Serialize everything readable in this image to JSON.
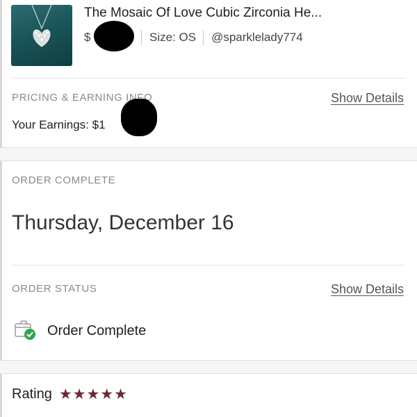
{
  "product": {
    "title": "The Mosaic Of Love Cubic Zirconia He...",
    "price_prefix": "$",
    "size": "Size: OS",
    "seller": "@sparklelady774",
    "image_icon": "heart-pendant-necklace-image"
  },
  "pricing": {
    "section_label": "PRICING & EARNING INFO",
    "show_details": "Show Details",
    "earnings": "Your Earnings: $1"
  },
  "order_complete": {
    "section_label": "ORDER COMPLETE",
    "date": "Thursday, December 16"
  },
  "order_status": {
    "section_label": "ORDER STATUS",
    "show_details": "Show Details",
    "status_text": "Order Complete",
    "status_icon": "package-check-icon"
  },
  "rating": {
    "label": "Rating",
    "stars": 5,
    "stars_text": "★★★★★"
  },
  "colors": {
    "star": "#6b2a33",
    "check": "#2fa44f",
    "label_gray": "#8a8a8a"
  }
}
